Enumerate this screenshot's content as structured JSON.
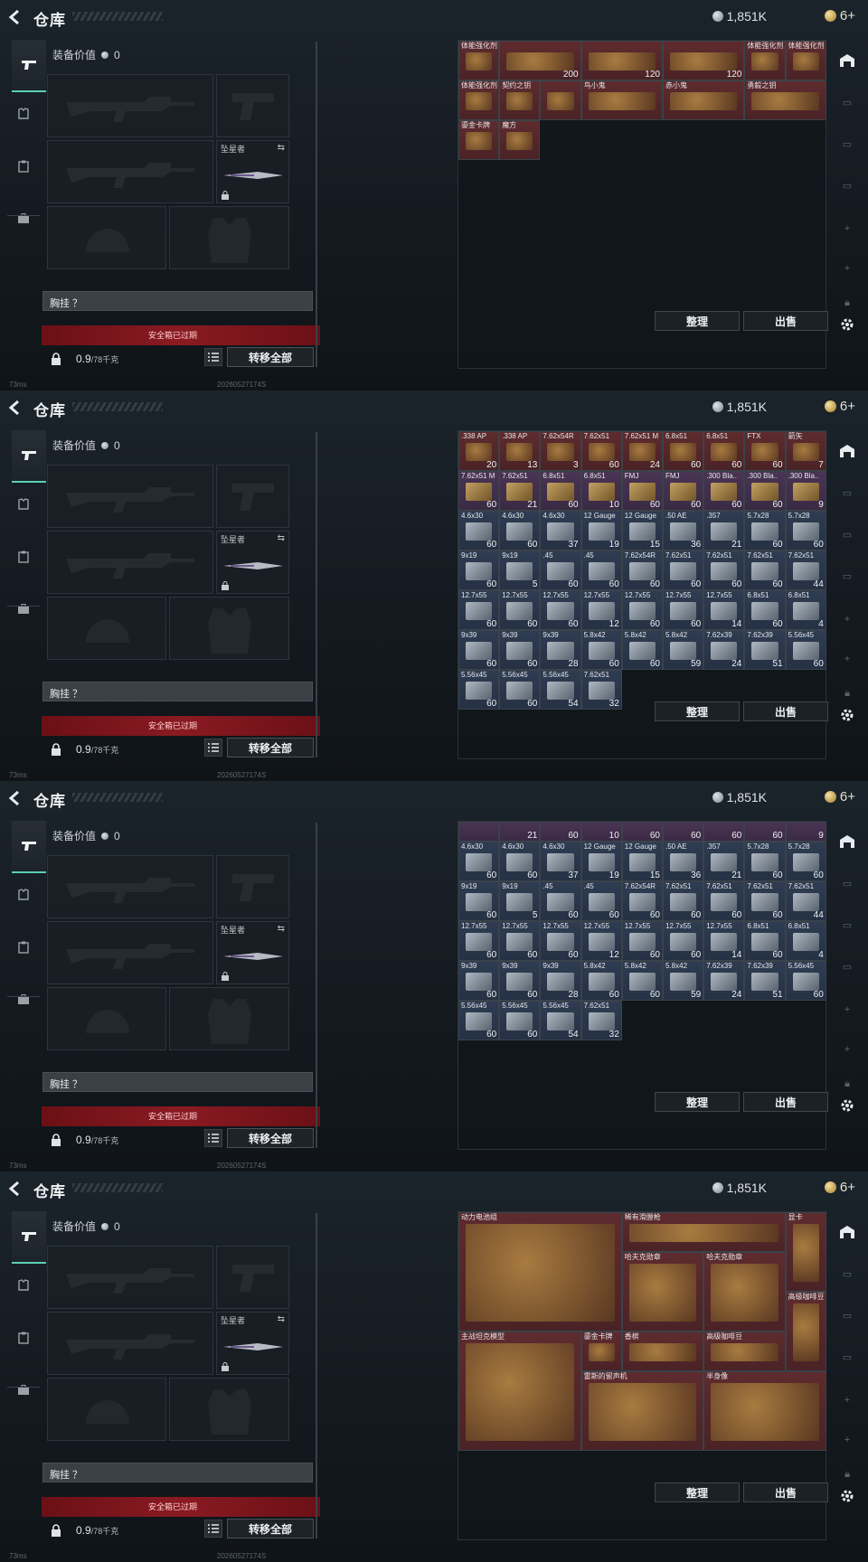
{
  "header": {
    "title": "仓库",
    "currency": "1,851K",
    "level": "6+"
  },
  "equipment": {
    "value_label": "装备价值",
    "value": "0",
    "melee_label": "坠星者",
    "chest_label": "胸挂 ？",
    "safe_box": "安全箱已过期",
    "weight_main": "0.9",
    "weight_cap": "/78千克",
    "transfer_all": "转移全部"
  },
  "actions": {
    "sort": "整理",
    "sell": "出售"
  },
  "status": {
    "ping": "73ms",
    "version": "20260527174S"
  },
  "colors": {
    "gold": "#8a6e2a",
    "red": "#6e2a2a",
    "blue": "#2f4a6a",
    "green": "#3f5a30",
    "grey": "#3b4249",
    "purple": "#4a3250",
    "accent": "#5bd0b5"
  },
  "panels": [
    {
      "cells": [
        {
          "c": 0,
          "r": 0,
          "name": "体能强化剂",
          "bg": "red"
        },
        {
          "c": 1,
          "r": 0,
          "w": 2,
          "name": "",
          "dur": "200",
          "bg": "red"
        },
        {
          "c": 3,
          "r": 0,
          "w": 2,
          "name": "",
          "dur": "120",
          "bg": "red"
        },
        {
          "c": 5,
          "r": 0,
          "w": 2,
          "name": "",
          "dur": "120",
          "bg": "red"
        },
        {
          "c": 7,
          "r": 0,
          "name": "体能强化剂",
          "bg": "red"
        },
        {
          "c": 8,
          "r": 0,
          "name": "体能强化剂",
          "bg": "red"
        },
        {
          "c": 0,
          "r": 1,
          "name": "体能强化剂",
          "bg": "red"
        },
        {
          "c": 1,
          "r": 1,
          "name": "契约之钥",
          "bg": "red"
        },
        {
          "c": 2,
          "r": 1,
          "name": "",
          "bg": "red"
        },
        {
          "c": 3,
          "r": 1,
          "w": 2,
          "name": "鸟小鬼",
          "bg": "red"
        },
        {
          "c": 5,
          "r": 1,
          "w": 2,
          "name": "赤小鬼",
          "bg": "red"
        },
        {
          "c": 7,
          "r": 1,
          "w": 2,
          "name": "勇毅之钥",
          "bg": "red"
        },
        {
          "c": 0,
          "r": 2,
          "name": "鎏金卡牌",
          "bg": "red"
        },
        {
          "c": 1,
          "r": 2,
          "name": "魔方",
          "bg": "red"
        }
      ]
    },
    {
      "cells": [
        {
          "c": 0,
          "r": 0,
          "name": ".338 AP",
          "cnt": "20",
          "bg": "red"
        },
        {
          "c": 1,
          "r": 0,
          "name": ".338 AP",
          "cnt": "13",
          "bg": "red"
        },
        {
          "c": 2,
          "r": 0,
          "name": "7.62x54R",
          "cnt": "3",
          "bg": "red"
        },
        {
          "c": 3,
          "r": 0,
          "name": "7.62x51",
          "cnt": "60",
          "bg": "red"
        },
        {
          "c": 4,
          "r": 0,
          "name": "7.62x51 M",
          "cnt": "24",
          "bg": "red"
        },
        {
          "c": 5,
          "r": 0,
          "name": "6.8x51",
          "cnt": "60",
          "bg": "red"
        },
        {
          "c": 6,
          "r": 0,
          "name": "6.8x51",
          "cnt": "60",
          "bg": "red"
        },
        {
          "c": 7,
          "r": 0,
          "name": "FTX",
          "cnt": "60",
          "bg": "red"
        },
        {
          "c": 8,
          "r": 0,
          "name": "箭矢",
          "cnt": "7",
          "bg": "red"
        },
        {
          "c": 0,
          "r": 1,
          "name": "7.62x51 M",
          "cnt": "60",
          "bg": "purple"
        },
        {
          "c": 1,
          "r": 1,
          "name": "7.62x51",
          "cnt": "21",
          "bg": "purple"
        },
        {
          "c": 2,
          "r": 1,
          "name": "6.8x51",
          "cnt": "60",
          "bg": "purple"
        },
        {
          "c": 3,
          "r": 1,
          "name": "6.8x51",
          "cnt": "10",
          "bg": "purple"
        },
        {
          "c": 4,
          "r": 1,
          "name": "FMJ",
          "cnt": "60",
          "bg": "purple"
        },
        {
          "c": 5,
          "r": 1,
          "name": "FMJ",
          "cnt": "60",
          "bg": "purple"
        },
        {
          "c": 6,
          "r": 1,
          "name": ".300 Bla..",
          "cnt": "60",
          "bg": "purple"
        },
        {
          "c": 7,
          "r": 1,
          "name": ".300 Bla..",
          "cnt": "60",
          "bg": "purple"
        },
        {
          "c": 8,
          "r": 1,
          "name": ".300 Bla..",
          "cnt": "9",
          "bg": "purple"
        },
        {
          "c": 0,
          "r": 2,
          "name": "4.6x30",
          "cnt": "60",
          "bg": "blue"
        },
        {
          "c": 1,
          "r": 2,
          "name": "4.6x30",
          "cnt": "60",
          "bg": "blue"
        },
        {
          "c": 2,
          "r": 2,
          "name": "4.6x30",
          "cnt": "37",
          "bg": "blue"
        },
        {
          "c": 3,
          "r": 2,
          "name": "12 Gauge",
          "cnt": "19",
          "bg": "blue"
        },
        {
          "c": 4,
          "r": 2,
          "name": "12 Gauge",
          "cnt": "15",
          "bg": "blue"
        },
        {
          "c": 5,
          "r": 2,
          "name": ".50 AE",
          "cnt": "36",
          "bg": "blue"
        },
        {
          "c": 6,
          "r": 2,
          "name": ".357",
          "cnt": "21",
          "bg": "blue"
        },
        {
          "c": 7,
          "r": 2,
          "name": "5.7x28",
          "cnt": "60",
          "bg": "blue"
        },
        {
          "c": 8,
          "r": 2,
          "name": "5.7x28",
          "cnt": "60",
          "bg": "blue"
        },
        {
          "c": 0,
          "r": 3,
          "name": "9x19",
          "cnt": "60",
          "bg": "blue"
        },
        {
          "c": 1,
          "r": 3,
          "name": "9x19",
          "cnt": "5",
          "bg": "blue"
        },
        {
          "c": 2,
          "r": 3,
          "name": ".45",
          "cnt": "60",
          "bg": "blue"
        },
        {
          "c": 3,
          "r": 3,
          "name": ".45",
          "cnt": "60",
          "bg": "blue"
        },
        {
          "c": 4,
          "r": 3,
          "name": "7.62x54R",
          "cnt": "60",
          "bg": "blue"
        },
        {
          "c": 5,
          "r": 3,
          "name": "7.62x51",
          "cnt": "60",
          "bg": "blue"
        },
        {
          "c": 6,
          "r": 3,
          "name": "7.62x51",
          "cnt": "60",
          "bg": "blue"
        },
        {
          "c": 7,
          "r": 3,
          "name": "7.62x51",
          "cnt": "60",
          "bg": "blue"
        },
        {
          "c": 8,
          "r": 3,
          "name": "7.62x51",
          "cnt": "44",
          "bg": "blue"
        },
        {
          "c": 0,
          "r": 4,
          "name": "12.7x55",
          "cnt": "60",
          "bg": "blue"
        },
        {
          "c": 1,
          "r": 4,
          "name": "12.7x55",
          "cnt": "60",
          "bg": "blue"
        },
        {
          "c": 2,
          "r": 4,
          "name": "12.7x55",
          "cnt": "60",
          "bg": "blue"
        },
        {
          "c": 3,
          "r": 4,
          "name": "12.7x55",
          "cnt": "12",
          "bg": "blue"
        },
        {
          "c": 4,
          "r": 4,
          "name": "12.7x55",
          "cnt": "60",
          "bg": "blue"
        },
        {
          "c": 5,
          "r": 4,
          "name": "12.7x55",
          "cnt": "60",
          "bg": "blue"
        },
        {
          "c": 6,
          "r": 4,
          "name": "12.7x55",
          "cnt": "14",
          "bg": "blue"
        },
        {
          "c": 7,
          "r": 4,
          "name": "6.8x51",
          "cnt": "60",
          "bg": "blue"
        },
        {
          "c": 8,
          "r": 4,
          "name": "6.8x51",
          "cnt": "4",
          "bg": "blue"
        },
        {
          "c": 0,
          "r": 5,
          "name": "9x39",
          "cnt": "60",
          "bg": "blue"
        },
        {
          "c": 1,
          "r": 5,
          "name": "9x39",
          "cnt": "60",
          "bg": "blue"
        },
        {
          "c": 2,
          "r": 5,
          "name": "9x39",
          "cnt": "28",
          "bg": "blue"
        },
        {
          "c": 3,
          "r": 5,
          "name": "5.8x42",
          "cnt": "60",
          "bg": "blue"
        },
        {
          "c": 4,
          "r": 5,
          "name": "5.8x42",
          "cnt": "60",
          "bg": "blue"
        },
        {
          "c": 5,
          "r": 5,
          "name": "5.8x42",
          "cnt": "59",
          "bg": "blue"
        },
        {
          "c": 6,
          "r": 5,
          "name": "7.62x39",
          "cnt": "24",
          "bg": "blue"
        },
        {
          "c": 7,
          "r": 5,
          "name": "7.62x39",
          "cnt": "51",
          "bg": "blue"
        },
        {
          "c": 8,
          "r": 5,
          "name": "5.56x45",
          "cnt": "60",
          "bg": "blue"
        },
        {
          "c": 0,
          "r": 6,
          "name": "5.56x45",
          "cnt": "60",
          "bg": "blue"
        },
        {
          "c": 1,
          "r": 6,
          "name": "5.56x45",
          "cnt": "60",
          "bg": "blue"
        },
        {
          "c": 2,
          "r": 6,
          "name": "5.56x45",
          "cnt": "54",
          "bg": "blue"
        },
        {
          "c": 3,
          "r": 6,
          "name": "7.62x51",
          "cnt": "32",
          "bg": "blue"
        }
      ]
    },
    {
      "cells": [
        {
          "c": 0,
          "r": 0,
          "name": "",
          "cnt": "",
          "bg": "purple",
          "h": 0.5
        },
        {
          "c": 1,
          "r": 0,
          "name": "",
          "cnt": "21",
          "bg": "purple",
          "h": 0.5
        },
        {
          "c": 2,
          "r": 0,
          "name": "",
          "cnt": "60",
          "bg": "purple",
          "h": 0.5
        },
        {
          "c": 3,
          "r": 0,
          "name": "",
          "cnt": "10",
          "bg": "purple",
          "h": 0.5
        },
        {
          "c": 4,
          "r": 0,
          "name": "",
          "cnt": "60",
          "bg": "purple",
          "h": 0.5
        },
        {
          "c": 5,
          "r": 0,
          "name": "",
          "cnt": "60",
          "bg": "purple",
          "h": 0.5
        },
        {
          "c": 6,
          "r": 0,
          "name": "",
          "cnt": "60",
          "bg": "purple",
          "h": 0.5
        },
        {
          "c": 7,
          "r": 0,
          "name": "",
          "cnt": "60",
          "bg": "purple",
          "h": 0.5
        },
        {
          "c": 8,
          "r": 0,
          "name": "",
          "cnt": "9",
          "bg": "purple",
          "h": 0.5
        },
        {
          "c": 0,
          "r": 0.5,
          "name": "4.6x30",
          "cnt": "60",
          "bg": "blue"
        },
        {
          "c": 1,
          "r": 0.5,
          "name": "4.6x30",
          "cnt": "60",
          "bg": "blue"
        },
        {
          "c": 2,
          "r": 0.5,
          "name": "4.6x30",
          "cnt": "37",
          "bg": "blue"
        },
        {
          "c": 3,
          "r": 0.5,
          "name": "12 Gauge",
          "cnt": "19",
          "bg": "blue"
        },
        {
          "c": 4,
          "r": 0.5,
          "name": "12 Gauge",
          "cnt": "15",
          "bg": "blue"
        },
        {
          "c": 5,
          "r": 0.5,
          "name": ".50 AE",
          "cnt": "36",
          "bg": "blue"
        },
        {
          "c": 6,
          "r": 0.5,
          "name": ".357",
          "cnt": "21",
          "bg": "blue"
        },
        {
          "c": 7,
          "r": 0.5,
          "name": "5.7x28",
          "cnt": "60",
          "bg": "blue"
        },
        {
          "c": 8,
          "r": 0.5,
          "name": "5.7x28",
          "cnt": "60",
          "bg": "blue"
        },
        {
          "c": 0,
          "r": 1.5,
          "name": "9x19",
          "cnt": "60",
          "bg": "blue"
        },
        {
          "c": 1,
          "r": 1.5,
          "name": "9x19",
          "cnt": "5",
          "bg": "blue"
        },
        {
          "c": 2,
          "r": 1.5,
          "name": ".45",
          "cnt": "60",
          "bg": "blue"
        },
        {
          "c": 3,
          "r": 1.5,
          "name": ".45",
          "cnt": "60",
          "bg": "blue"
        },
        {
          "c": 4,
          "r": 1.5,
          "name": "7.62x54R",
          "cnt": "60",
          "bg": "blue"
        },
        {
          "c": 5,
          "r": 1.5,
          "name": "7.62x51",
          "cnt": "60",
          "bg": "blue"
        },
        {
          "c": 6,
          "r": 1.5,
          "name": "7.62x51",
          "cnt": "60",
          "bg": "blue"
        },
        {
          "c": 7,
          "r": 1.5,
          "name": "7.62x51",
          "cnt": "60",
          "bg": "blue"
        },
        {
          "c": 8,
          "r": 1.5,
          "name": "7.62x51",
          "cnt": "44",
          "bg": "blue"
        },
        {
          "c": 0,
          "r": 2.5,
          "name": "12.7x55",
          "cnt": "60",
          "bg": "blue"
        },
        {
          "c": 1,
          "r": 2.5,
          "name": "12.7x55",
          "cnt": "60",
          "bg": "blue"
        },
        {
          "c": 2,
          "r": 2.5,
          "name": "12.7x55",
          "cnt": "60",
          "bg": "blue"
        },
        {
          "c": 3,
          "r": 2.5,
          "name": "12.7x55",
          "cnt": "12",
          "bg": "blue"
        },
        {
          "c": 4,
          "r": 2.5,
          "name": "12.7x55",
          "cnt": "60",
          "bg": "blue"
        },
        {
          "c": 5,
          "r": 2.5,
          "name": "12.7x55",
          "cnt": "60",
          "bg": "blue"
        },
        {
          "c": 6,
          "r": 2.5,
          "name": "12.7x55",
          "cnt": "14",
          "bg": "blue"
        },
        {
          "c": 7,
          "r": 2.5,
          "name": "6.8x51",
          "cnt": "60",
          "bg": "blue"
        },
        {
          "c": 8,
          "r": 2.5,
          "name": "6.8x51",
          "cnt": "4",
          "bg": "blue"
        },
        {
          "c": 0,
          "r": 3.5,
          "name": "9x39",
          "cnt": "60",
          "bg": "blue"
        },
        {
          "c": 1,
          "r": 3.5,
          "name": "9x39",
          "cnt": "60",
          "bg": "blue"
        },
        {
          "c": 2,
          "r": 3.5,
          "name": "9x39",
          "cnt": "28",
          "bg": "blue"
        },
        {
          "c": 3,
          "r": 3.5,
          "name": "5.8x42",
          "cnt": "60",
          "bg": "blue"
        },
        {
          "c": 4,
          "r": 3.5,
          "name": "5.8x42",
          "cnt": "60",
          "bg": "blue"
        },
        {
          "c": 5,
          "r": 3.5,
          "name": "5.8x42",
          "cnt": "59",
          "bg": "blue"
        },
        {
          "c": 6,
          "r": 3.5,
          "name": "7.62x39",
          "cnt": "24",
          "bg": "blue"
        },
        {
          "c": 7,
          "r": 3.5,
          "name": "7.62x39",
          "cnt": "51",
          "bg": "blue"
        },
        {
          "c": 8,
          "r": 3.5,
          "name": "5.56x45",
          "cnt": "60",
          "bg": "blue"
        },
        {
          "c": 0,
          "r": 4.5,
          "name": "5.56x45",
          "cnt": "60",
          "bg": "blue"
        },
        {
          "c": 1,
          "r": 4.5,
          "name": "5.56x45",
          "cnt": "60",
          "bg": "blue"
        },
        {
          "c": 2,
          "r": 4.5,
          "name": "5.56x45",
          "cnt": "54",
          "bg": "blue"
        },
        {
          "c": 3,
          "r": 4.5,
          "name": "7.62x51",
          "cnt": "32",
          "bg": "blue"
        }
      ]
    },
    {
      "cells": [
        {
          "c": 0,
          "r": 0,
          "w": 4,
          "h": 3,
          "name": "动力电池组",
          "bg": "red"
        },
        {
          "c": 4,
          "r": 0,
          "w": 4,
          "h": 1,
          "name": "稀有滑膛枪",
          "bg": "red"
        },
        {
          "c": 8,
          "r": 0,
          "w": 1,
          "h": 2,
          "name": "显卡",
          "bg": "red"
        },
        {
          "c": 4,
          "r": 1,
          "w": 2,
          "h": 2,
          "name": "哈夫克勋章",
          "bg": "red"
        },
        {
          "c": 6,
          "r": 1,
          "w": 2,
          "h": 2,
          "name": "哈夫克勋章",
          "bg": "red"
        },
        {
          "c": 8,
          "r": 2,
          "w": 1,
          "h": 2,
          "name": "高级咖啡豆",
          "bg": "red"
        },
        {
          "c": 0,
          "r": 3,
          "w": 3,
          "h": 3,
          "name": "主战坦克模型",
          "bg": "red"
        },
        {
          "c": 3,
          "r": 3,
          "w": 1,
          "h": 1,
          "name": "鎏金卡牌",
          "bg": "red"
        },
        {
          "c": 4,
          "r": 3,
          "w": 2,
          "h": 1,
          "name": "香槟",
          "bg": "red"
        },
        {
          "c": 6,
          "r": 3,
          "w": 2,
          "h": 1,
          "name": "高级咖啡豆",
          "bg": "red"
        },
        {
          "c": 3,
          "r": 4,
          "w": 3,
          "h": 2,
          "name": "雷斯的留声机",
          "bg": "red"
        },
        {
          "c": 6,
          "r": 4,
          "w": 3,
          "h": 2,
          "name": "半身像",
          "bg": "red"
        }
      ]
    }
  ]
}
